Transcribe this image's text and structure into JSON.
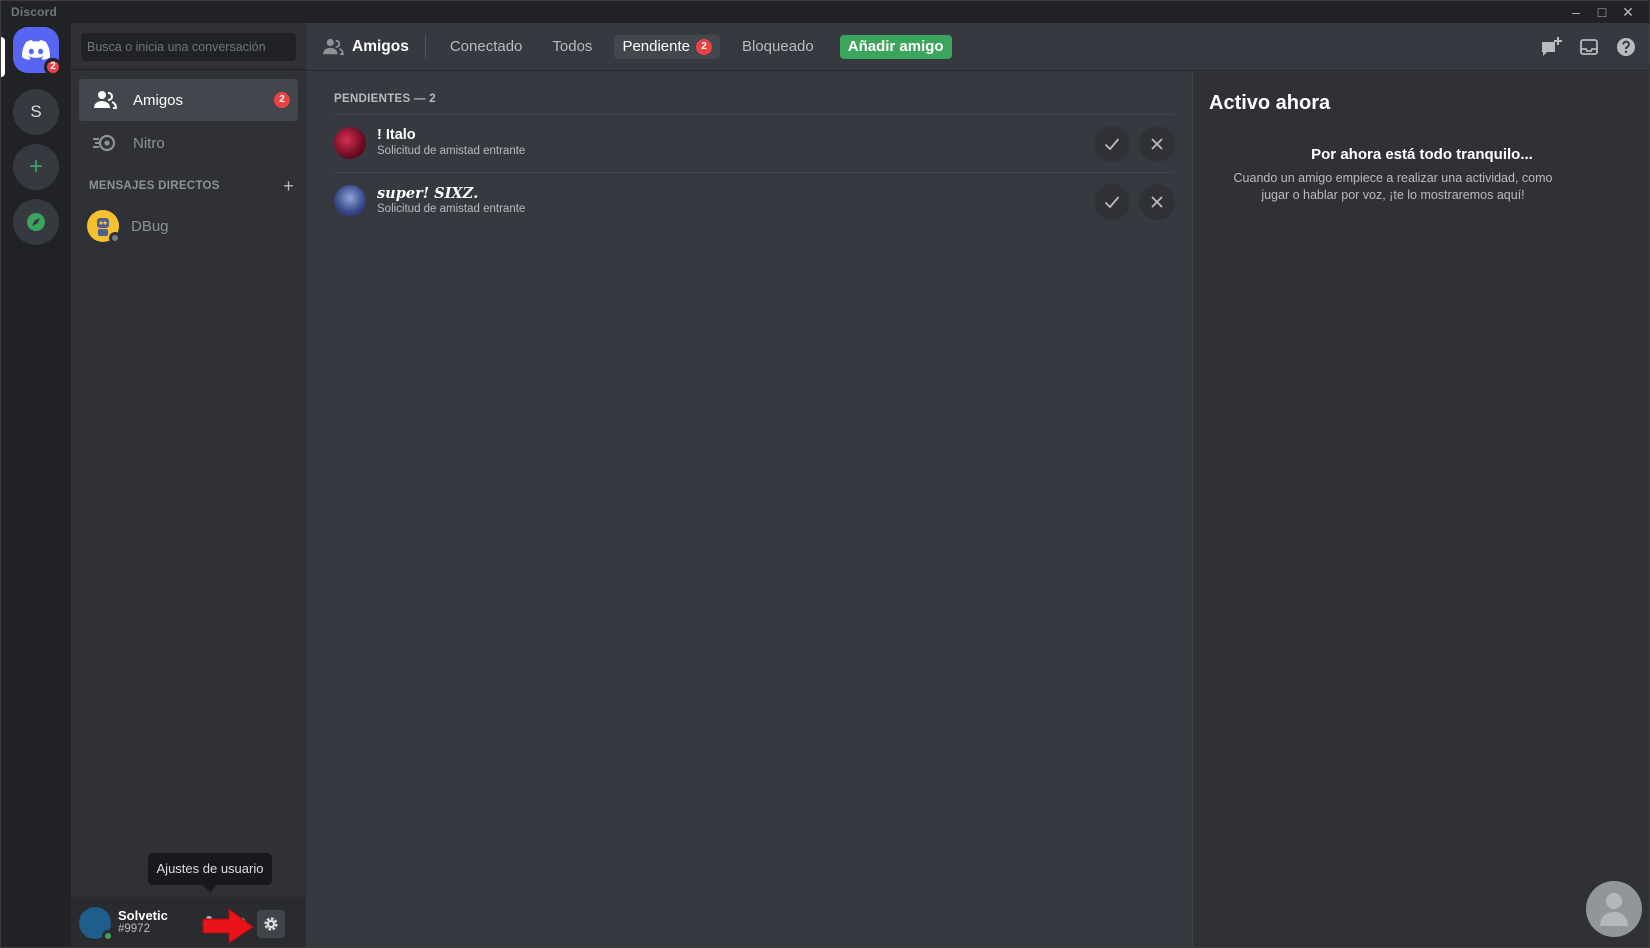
{
  "window": {
    "app_name": "Discord"
  },
  "rail": {
    "home_badge": "2",
    "server_initial": "S"
  },
  "sidebar": {
    "search_placeholder": "Busca o inicia una conversación",
    "nav": [
      {
        "label": "Amigos",
        "badge": "2"
      },
      {
        "label": "Nitro"
      }
    ],
    "dm_header": "MENSAJES DIRECTOS",
    "dm_add": "+",
    "dms": [
      {
        "name": "DBug"
      }
    ]
  },
  "user_panel": {
    "name": "Solvetic",
    "tag": "#9972",
    "settings_tooltip": "Ajustes de usuario"
  },
  "topbar": {
    "title": "Amigos",
    "tabs": [
      {
        "label": "Conectado"
      },
      {
        "label": "Todos"
      },
      {
        "label": "Pendiente",
        "badge": "2"
      },
      {
        "label": "Bloqueado"
      }
    ],
    "add_friend": "Añadir amigo"
  },
  "pending": {
    "header": "PENDIENTES — 2",
    "requests": [
      {
        "name": "! Italo",
        "status": "Solicitud de amistad entrante",
        "avatar_color": "#8a1030"
      },
      {
        "name": "super! 𝑺𝑰𝑿𝒁.",
        "status": "Solicitud de amistad entrante",
        "avatar_color": "#2d3a73"
      }
    ]
  },
  "active_now": {
    "title": "Activo ahora",
    "empty_title": "Por ahora está todo tranquilo...",
    "empty_desc": "Cuando un amigo empiece a realizar una actividad, como jugar o hablar por voz, ¡te lo mostraremos aquí!"
  },
  "colors": {
    "blurple": "#5865f2",
    "green": "#3ba55d",
    "red": "#ed4245",
    "bg_main": "#36393f",
    "bg_side": "#2f3136"
  },
  "icons": [
    "discord-logo-icon",
    "friends-icon",
    "nitro-icon",
    "plus-icon",
    "explore-icon",
    "mic-icon",
    "headphones-icon",
    "gear-icon",
    "new-group-dm-icon",
    "inbox-icon",
    "help-icon",
    "check-icon",
    "close-icon"
  ]
}
